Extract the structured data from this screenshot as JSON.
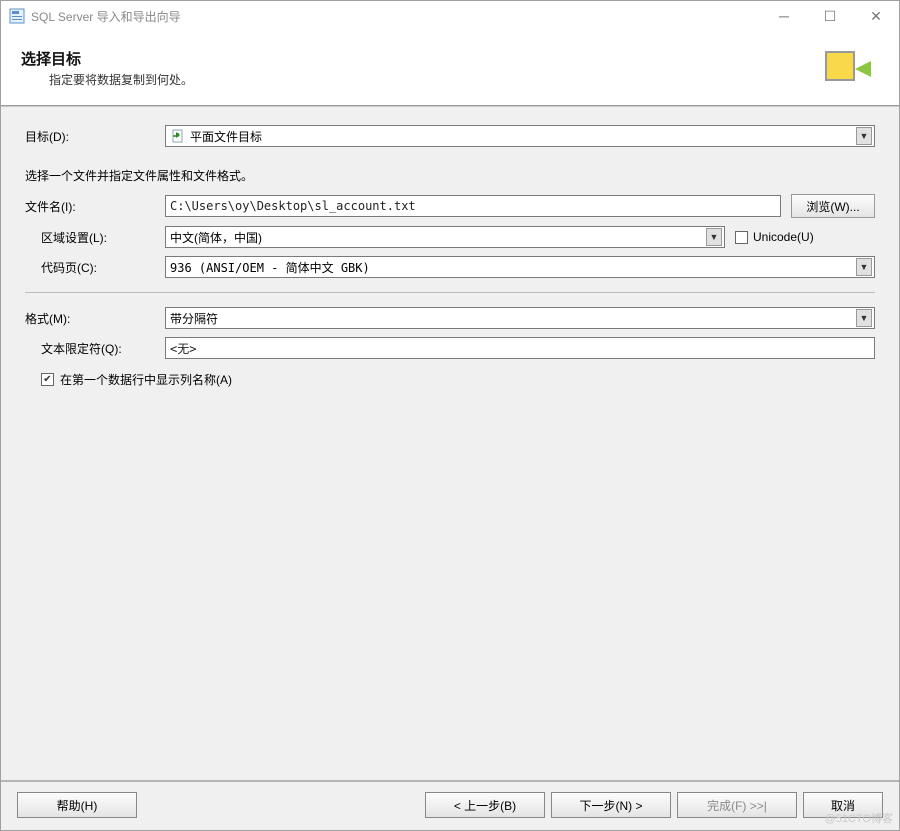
{
  "window": {
    "title": "SQL Server 导入和导出向导"
  },
  "header": {
    "title": "选择目标",
    "subtitle": "指定要将数据复制到何处。"
  },
  "form": {
    "destination_label": "目标(D):",
    "destination_value": "平面文件目标",
    "file_prompt": "选择一个文件并指定文件属性和文件格式。",
    "filename_label": "文件名(I):",
    "filename_value": "C:\\Users\\oy\\Desktop\\sl_account.txt",
    "browse_label": "浏览(W)...",
    "locale_label": "区域设置(L):",
    "locale_value": "中文(简体，中国)",
    "unicode_label": "Unicode(U)",
    "unicode_checked": false,
    "codepage_label": "代码页(C):",
    "codepage_value": "936   (ANSI/OEM - 简体中文 GBK)",
    "format_label": "格式(M):",
    "format_value": "带分隔符",
    "qualifier_label": "文本限定符(Q):",
    "qualifier_value": "<无>",
    "first_row_columns_label": "在第一个数据行中显示列名称(A)",
    "first_row_columns_checked": true
  },
  "buttons": {
    "help": "帮助(H)",
    "back": "< 上一步(B)",
    "next": "下一步(N) >",
    "finish": "完成(F) >>|",
    "cancel": "取消"
  },
  "watermark": "@51CTO博客"
}
